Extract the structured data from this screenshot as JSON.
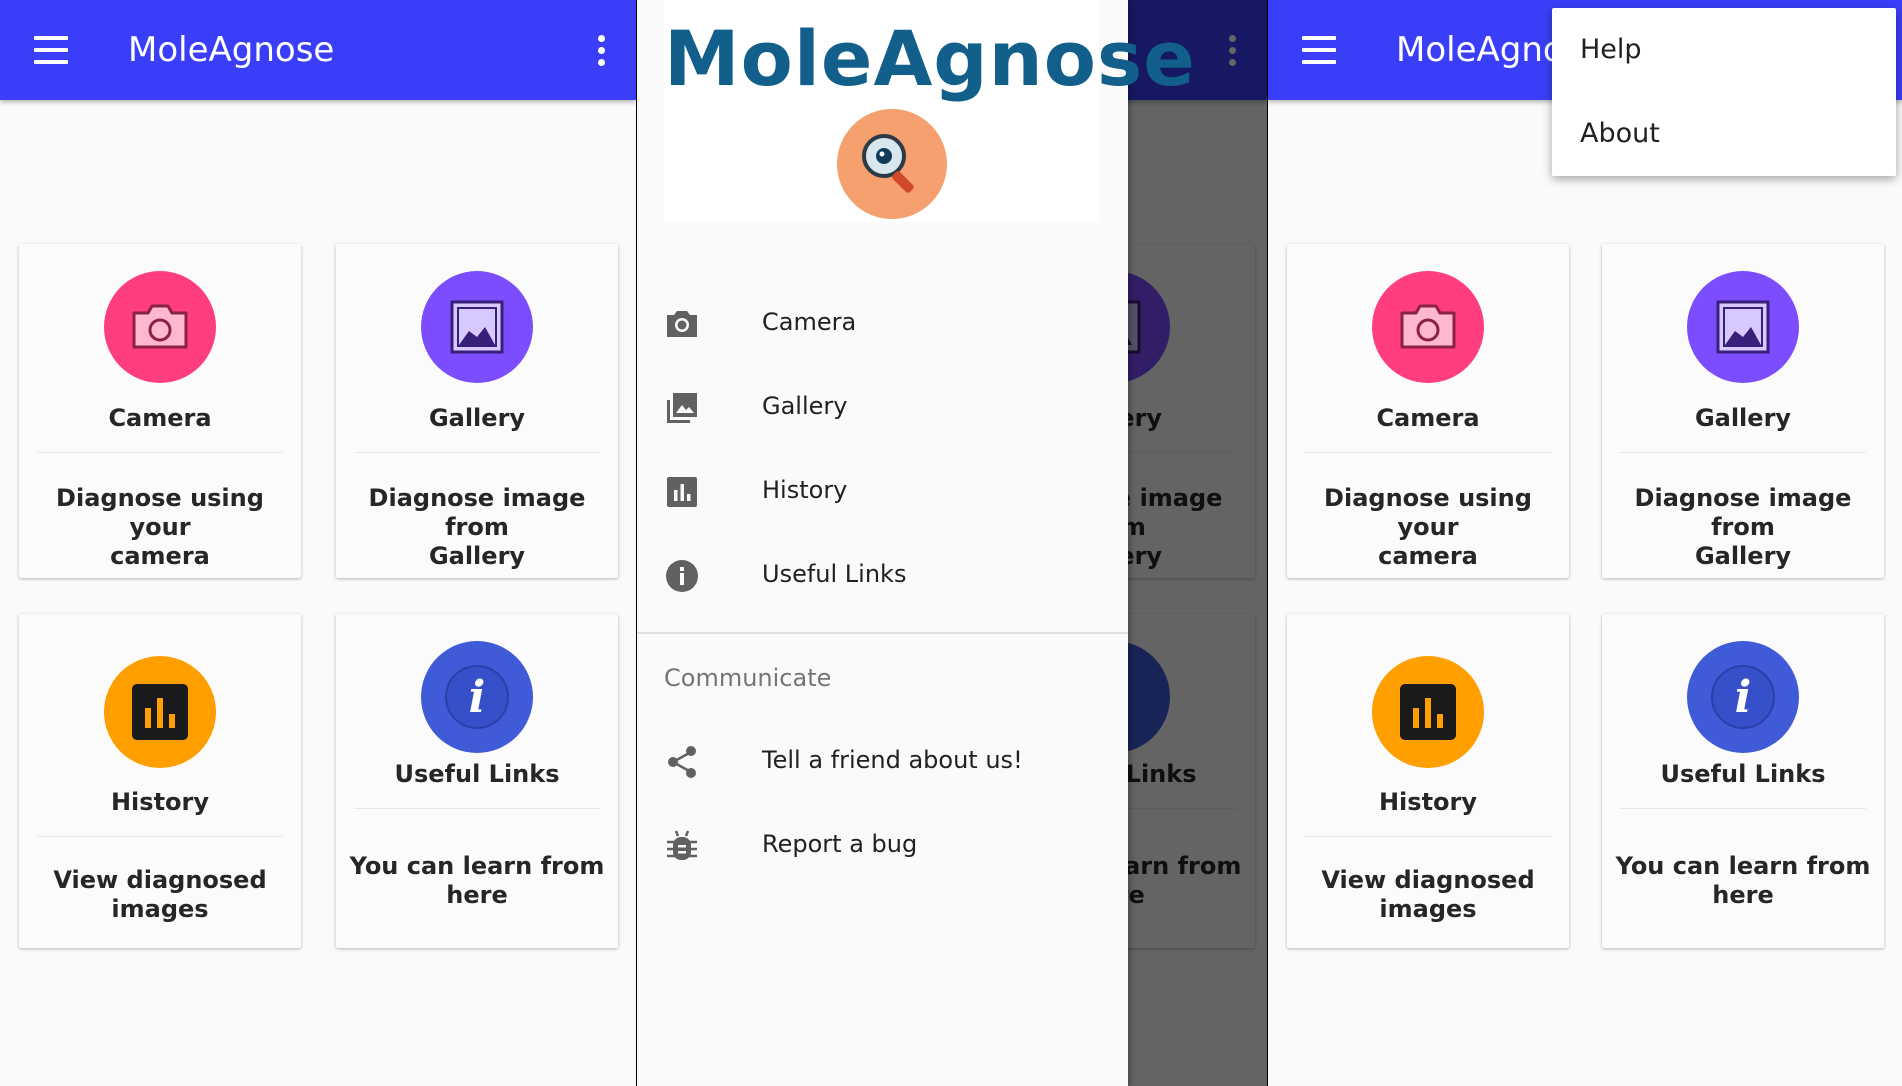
{
  "app": {
    "title": "MoleAgnose"
  },
  "cards": [
    {
      "label": "Camera",
      "desc_line1": "Diagnose using your",
      "desc_line2": "camera",
      "icon": "camera-icon",
      "color": "#ff3d7f"
    },
    {
      "label": "Gallery",
      "desc_line1": "Diagnose image from",
      "desc_line2": "Gallery",
      "icon": "image-icon",
      "color": "#7c4dff"
    },
    {
      "label": "History",
      "desc_line1": "View diagnosed images",
      "desc_line2": "",
      "icon": "bar-chart-icon",
      "color": "#ffa000"
    },
    {
      "label": "Useful Links",
      "desc_line1": "You can learn from",
      "desc_line2": "here",
      "icon": "info-icon",
      "color": "#3f5bd8"
    }
  ],
  "drawer": {
    "logo_text": "MoleAgnose",
    "items": [
      {
        "label": "Camera",
        "icon": "camera-icon"
      },
      {
        "label": "Gallery",
        "icon": "photo-library-icon"
      },
      {
        "label": "History",
        "icon": "bar-chart-icon"
      },
      {
        "label": "Useful Links",
        "icon": "info-icon"
      }
    ],
    "subheader": "Communicate",
    "communicate_items": [
      {
        "label": "Tell a friend about us!",
        "icon": "share-icon"
      },
      {
        "label": "Report a bug",
        "icon": "bug-icon"
      }
    ]
  },
  "menu": {
    "items": [
      {
        "label": "Help"
      },
      {
        "label": "About"
      }
    ]
  },
  "colors": {
    "app_bar": "#3a3ef8",
    "scrim_app_bar": "#17187a"
  }
}
